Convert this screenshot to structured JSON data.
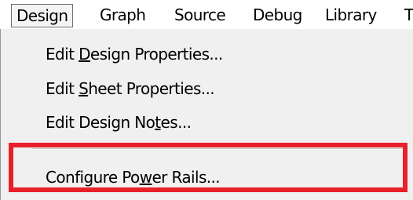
{
  "menubar": {
    "items": [
      {
        "label": "Design",
        "active": true
      },
      {
        "label": "Graph"
      },
      {
        "label": "Source"
      },
      {
        "label": "Debug"
      },
      {
        "label": "Library"
      },
      {
        "label": "T"
      }
    ]
  },
  "menu": {
    "items": [
      {
        "before": "Edit ",
        "mnemonic": "D",
        "after": "esign Properties..."
      },
      {
        "before": "Edit ",
        "mnemonic": "S",
        "after": "heet Properties..."
      },
      {
        "before": "Edit Design No",
        "mnemonic": "t",
        "after": "es..."
      },
      {
        "before": "Configure Po",
        "mnemonic": "w",
        "after": "er Rails..."
      }
    ]
  },
  "colors": {
    "highlight_border": "#e8202a",
    "menu_background": "#f0f0f0"
  }
}
